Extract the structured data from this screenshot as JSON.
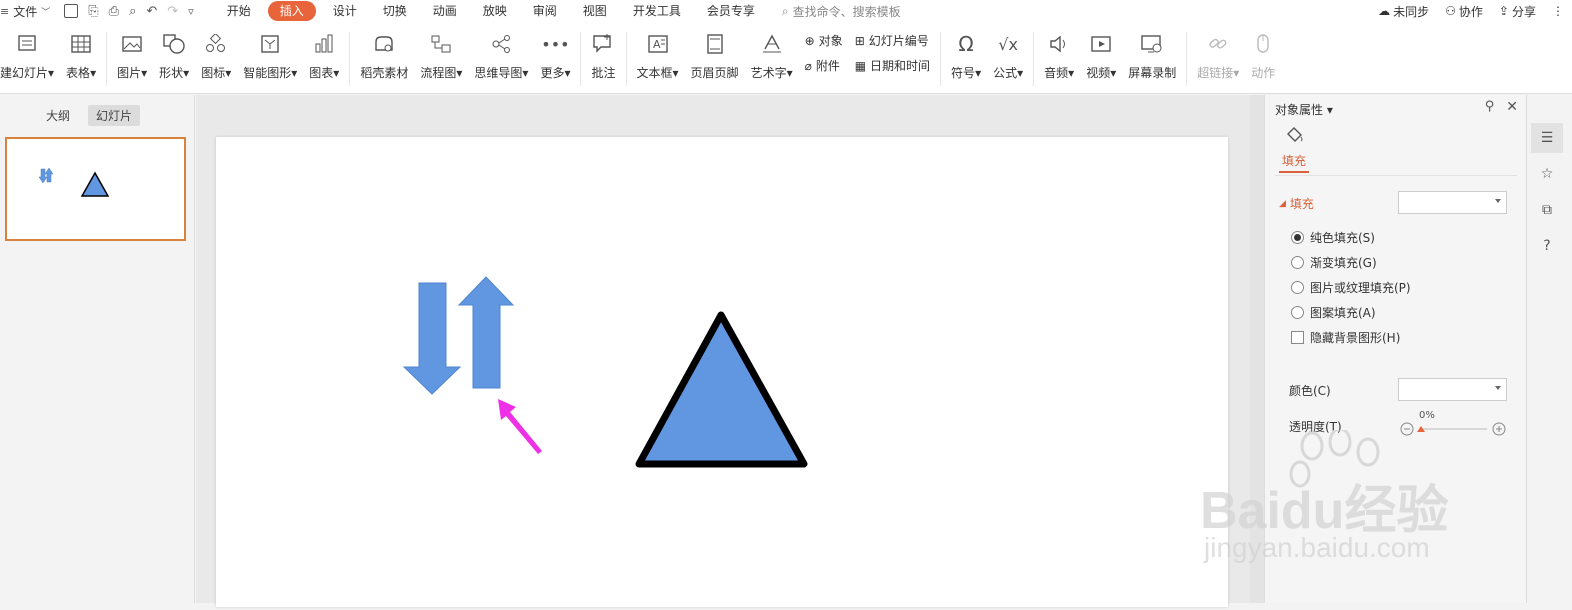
{
  "menubar": {
    "file_label": "文件",
    "tabs": [
      "开始",
      "插入",
      "设计",
      "切换",
      "动画",
      "放映",
      "审阅",
      "视图",
      "开发工具",
      "会员专享"
    ],
    "active_tab": "插入",
    "search_placeholder": "查找命令、搜索模板",
    "sync_label": "未同步",
    "collab_label": "协作",
    "share_label": "分享"
  },
  "ribbon": {
    "new_slide": "建幻灯片",
    "table": "表格",
    "picture": "图片",
    "shape": "形状",
    "icon": "图标",
    "smartart": "智能图形",
    "chart": "图表",
    "docer_material": "稻壳素材",
    "flowchart": "流程图",
    "mindmap": "思维导图",
    "more": "更多",
    "comment": "批注",
    "textbox": "文本框",
    "header_footer": "页眉页脚",
    "wordart": "艺术字",
    "object": "对象",
    "attachment": "附件",
    "slide_number": "幻灯片编号",
    "datetime": "日期和时间",
    "symbol": "符号",
    "formula": "公式",
    "audio": "音频",
    "video": "视频",
    "screen_record": "屏幕录制",
    "hyperlink": "超链接",
    "action": "动作"
  },
  "left_panel": {
    "tabs": [
      "大纲",
      "幻灯片"
    ],
    "active_tab": "幻灯片"
  },
  "property_panel": {
    "title": "对象属性",
    "fill_tab": "填充",
    "section_fill": "填充",
    "options": [
      {
        "label": "纯色填充(S)",
        "checked": true
      },
      {
        "label": "渐变填充(G)",
        "checked": false
      },
      {
        "label": "图片或纹理填充(P)",
        "checked": false
      },
      {
        "label": "图案填充(A)",
        "checked": false
      }
    ],
    "hide_bg": "隐藏背景图形(H)",
    "color_label": "颜色(C)",
    "transparency_label": "透明度(T)",
    "transparency_value": "0%"
  },
  "colors": {
    "accent": "#e8643a",
    "shape_fill": "#6196e0",
    "arrow_pointer": "#ee30e6",
    "thumb_border": "#d9823c"
  },
  "watermark": {
    "brand": "Baidu经验",
    "url": "jingyan.baidu.com"
  }
}
